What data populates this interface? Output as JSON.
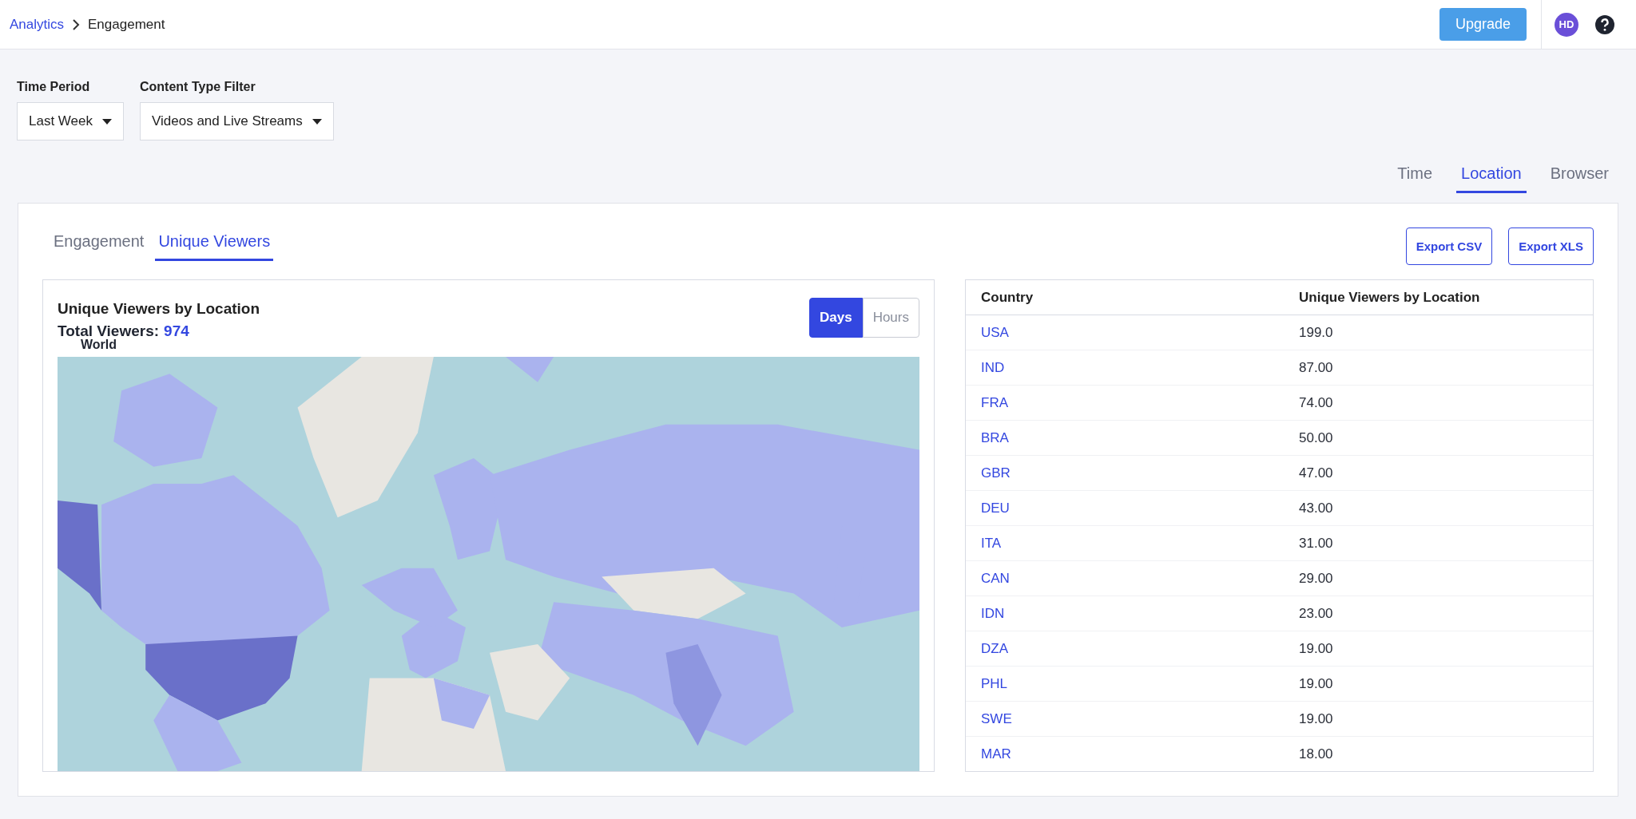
{
  "breadcrumb": {
    "parent": "Analytics",
    "current": "Engagement"
  },
  "header": {
    "upgrade": "Upgrade",
    "avatar": "HD"
  },
  "filters": [
    {
      "label": "Time Period",
      "value": "Last Week"
    },
    {
      "label": "Content Type Filter",
      "value": "Videos and Live Streams"
    }
  ],
  "view_tabs": [
    {
      "label": "Time",
      "selected": false
    },
    {
      "label": "Location",
      "selected": true
    },
    {
      "label": "Browser",
      "selected": false
    }
  ],
  "card": {
    "tabs": [
      {
        "label": "Engagement",
        "selected": false
      },
      {
        "label": "Unique Viewers",
        "selected": true
      }
    ],
    "exports": [
      "Export CSV",
      "Export XLS"
    ],
    "map_panel": {
      "title": "Unique Viewers by Location",
      "total_label": "Total Viewers:",
      "total_value": "974",
      "granularity": [
        {
          "label": "Days",
          "selected": true
        },
        {
          "label": "Hours",
          "selected": false
        }
      ],
      "map_title": "World"
    },
    "table": {
      "columns": [
        "Country",
        "Unique Viewers by Location"
      ],
      "rows": [
        {
          "country": "USA",
          "value": "199.0"
        },
        {
          "country": "IND",
          "value": "87.00"
        },
        {
          "country": "FRA",
          "value": "74.00"
        },
        {
          "country": "BRA",
          "value": "50.00"
        },
        {
          "country": "GBR",
          "value": "47.00"
        },
        {
          "country": "DEU",
          "value": "43.00"
        },
        {
          "country": "ITA",
          "value": "31.00"
        },
        {
          "country": "CAN",
          "value": "29.00"
        },
        {
          "country": "IDN",
          "value": "23.00"
        },
        {
          "country": "DZA",
          "value": "19.00"
        },
        {
          "country": "PHL",
          "value": "19.00"
        },
        {
          "country": "SWE",
          "value": "19.00"
        },
        {
          "country": "MAR",
          "value": "18.00"
        }
      ]
    }
  }
}
